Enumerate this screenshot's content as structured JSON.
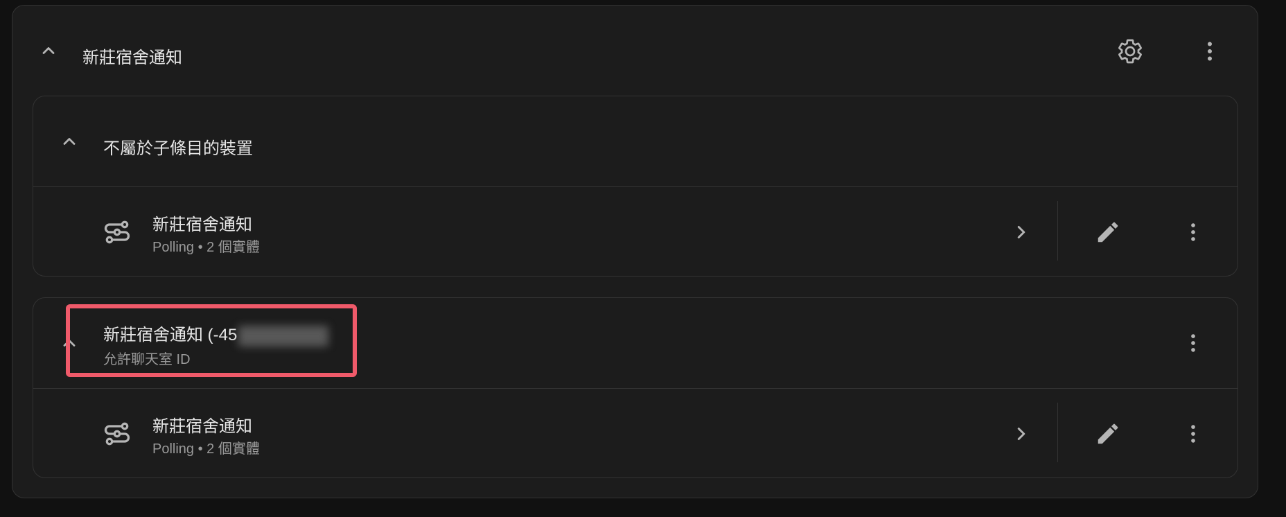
{
  "integration": {
    "title": "新莊宿舍通知",
    "settings_icon": "gear-icon",
    "menu_icon": "more-vert-icon"
  },
  "groups": [
    {
      "title": "不屬於子條目的裝置",
      "devices": [
        {
          "name": "新莊宿舍通知",
          "meta": "Polling • 2 個實體",
          "icon": "service-icon"
        }
      ]
    },
    {
      "title_prefix": "新莊宿舍通知 (-45",
      "subtitle": "允許聊天室 ID",
      "devices": [
        {
          "name": "新莊宿舍通知",
          "meta": "Polling • 2 個實體",
          "icon": "service-icon"
        }
      ]
    }
  ],
  "colors": {
    "background": "#111111",
    "card": "#1c1c1c",
    "border": "#333333",
    "highlight": "#f05a6a",
    "icon": "#b5b5b5"
  }
}
